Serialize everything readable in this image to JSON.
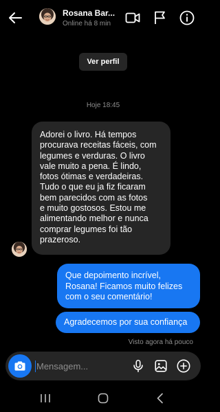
{
  "header": {
    "contact_name": "Rosana Bar...",
    "status": "Online há 8 min",
    "icons": [
      "back-arrow-icon",
      "video-camera-icon",
      "flag-icon",
      "info-icon"
    ]
  },
  "profile_button": {
    "label": "Ver perfil"
  },
  "conversation": {
    "timestamp": "Hoje 18:45",
    "messages": [
      {
        "from": "contact",
        "text": "Adorei o livro. Há tempos\nprocurava receitas fáceis, com\nlegumes e verduras. O livro\nvale muito a pena. É lindo,\nfotos ótimas e verdadeiras.\nTudo o que eu ja fiz ficaram\nbem parecidos com as fotos\ne muito gostosos. Estou me\nalimentando melhor e nunca\ncomprar legumes foi tão\nprazeroso."
      },
      {
        "from": "me",
        "text": "Que depoimento incrível,\nRosana! Ficamos muito felizes\ncom o seu comentário!"
      },
      {
        "from": "me",
        "text": "Agradecemos por sua confiança"
      }
    ],
    "seen": "Visto agora há pouco"
  },
  "composer": {
    "placeholder": "Mensagem...",
    "icons": [
      "camera-icon",
      "microphone-icon",
      "gallery-icon",
      "add-icon"
    ]
  },
  "system_nav": {
    "icons": [
      "recent-apps-icon",
      "home-icon",
      "back-icon"
    ]
  },
  "colors": {
    "background": "#000000",
    "incoming_bubble": "#262626",
    "outgoing_bubble": "#1877f2",
    "muted_text": "#8e8e8e"
  }
}
